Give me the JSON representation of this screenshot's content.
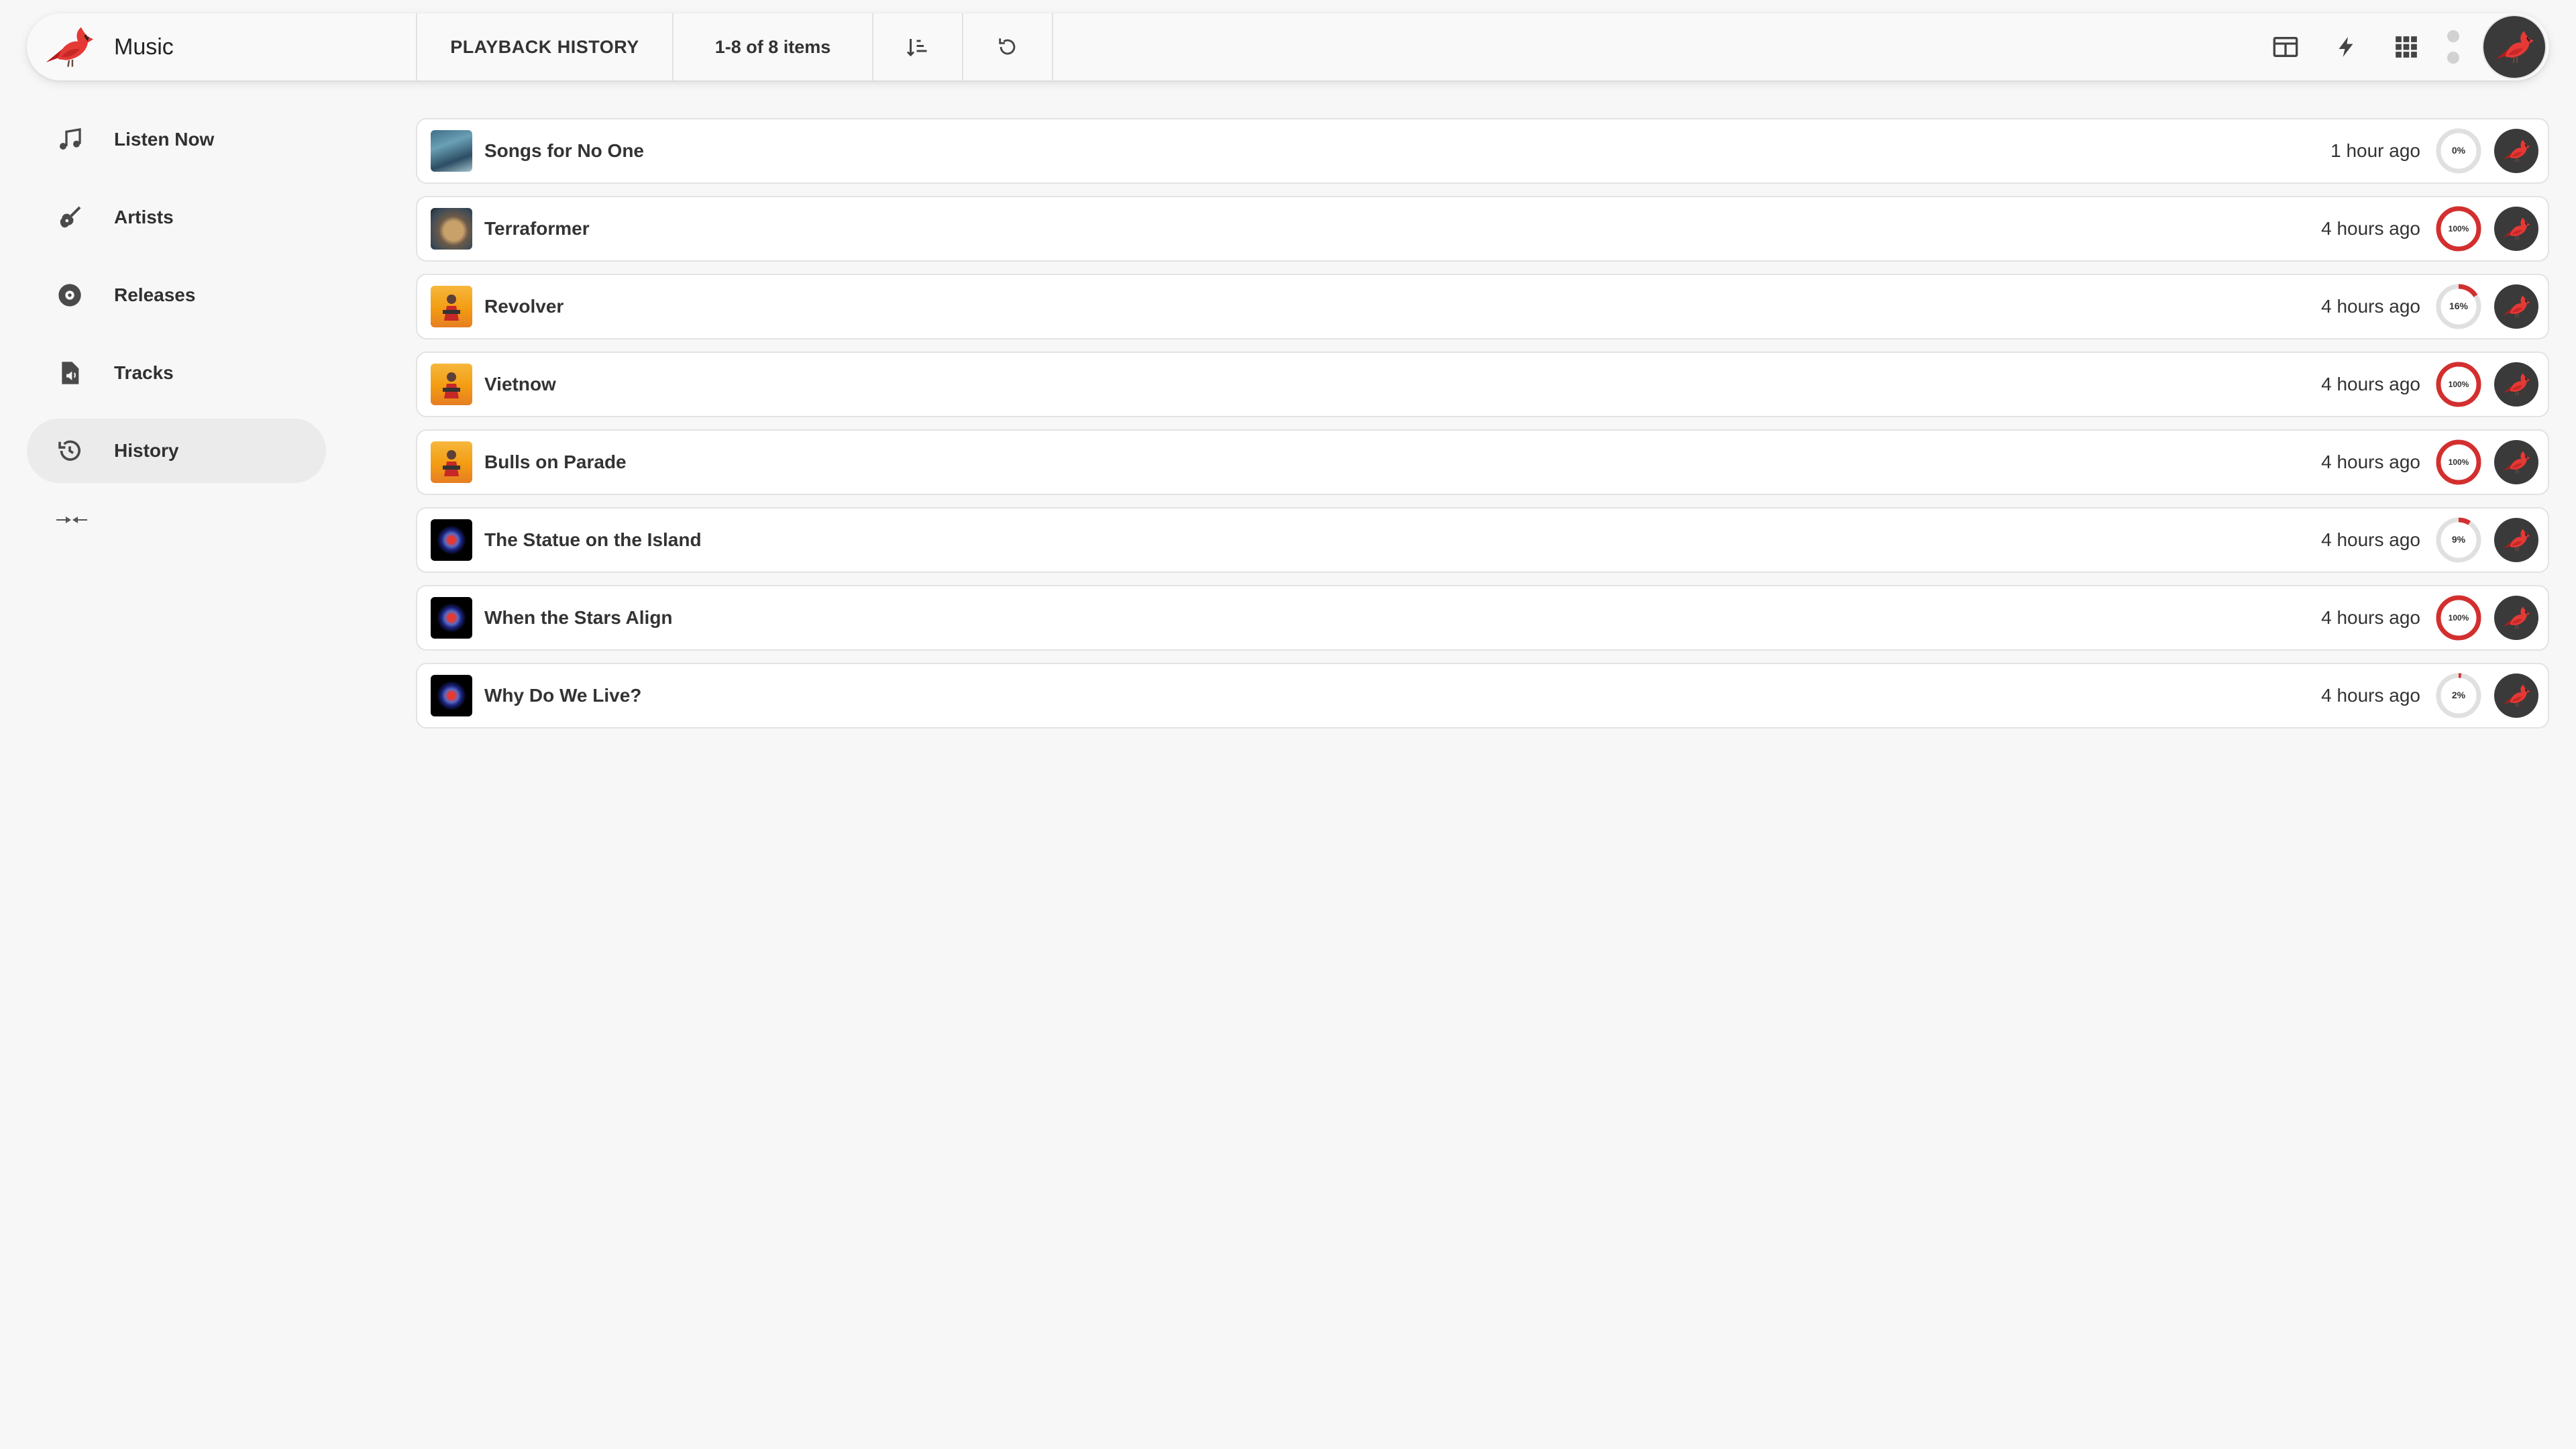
{
  "app": {
    "name": "Music"
  },
  "toolbar": {
    "title": "PLAYBACK HISTORY",
    "count": "1-8 of 8 items",
    "sort_icon": "sort-ascending-icon",
    "refresh_icon": "refresh-icon",
    "right_icons": [
      "split-view-icon",
      "lightning-icon",
      "apps-grid-icon",
      "status-dots-icon"
    ]
  },
  "sidebar": {
    "items": [
      {
        "label": "Listen Now",
        "icon": "music-note-icon",
        "active": false
      },
      {
        "label": "Artists",
        "icon": "guitar-icon",
        "active": false
      },
      {
        "label": "Releases",
        "icon": "disc-icon",
        "active": false
      },
      {
        "label": "Tracks",
        "icon": "audio-file-icon",
        "active": false
      },
      {
        "label": "History",
        "icon": "history-icon",
        "active": true
      }
    ],
    "collapse_icon": "collapse-icon"
  },
  "history": [
    {
      "title": "Songs for No One",
      "time": "1 hour ago",
      "progress": 0,
      "progress_label": "0%",
      "art": "blue"
    },
    {
      "title": "Terraformer",
      "time": "4 hours ago",
      "progress": 100,
      "progress_label": "100%",
      "art": "earth"
    },
    {
      "title": "Revolver",
      "time": "4 hours ago",
      "progress": 16,
      "progress_label": "16%",
      "art": "orange"
    },
    {
      "title": "Vietnow",
      "time": "4 hours ago",
      "progress": 100,
      "progress_label": "100%",
      "art": "orange"
    },
    {
      "title": "Bulls on Parade",
      "time": "4 hours ago",
      "progress": 100,
      "progress_label": "100%",
      "art": "orange"
    },
    {
      "title": "The Statue on the Island",
      "time": "4 hours ago",
      "progress": 9,
      "progress_label": "9%",
      "art": "dark"
    },
    {
      "title": "When the Stars Align",
      "time": "4 hours ago",
      "progress": 100,
      "progress_label": "100%",
      "art": "dark"
    },
    {
      "title": "Why Do We Live?",
      "time": "4 hours ago",
      "progress": 2,
      "progress_label": "2%",
      "art": "dark"
    }
  ],
  "colors": {
    "accent": "#d32f2f",
    "ring_track": "#e0e0e0",
    "background": "#f7f7f7"
  }
}
